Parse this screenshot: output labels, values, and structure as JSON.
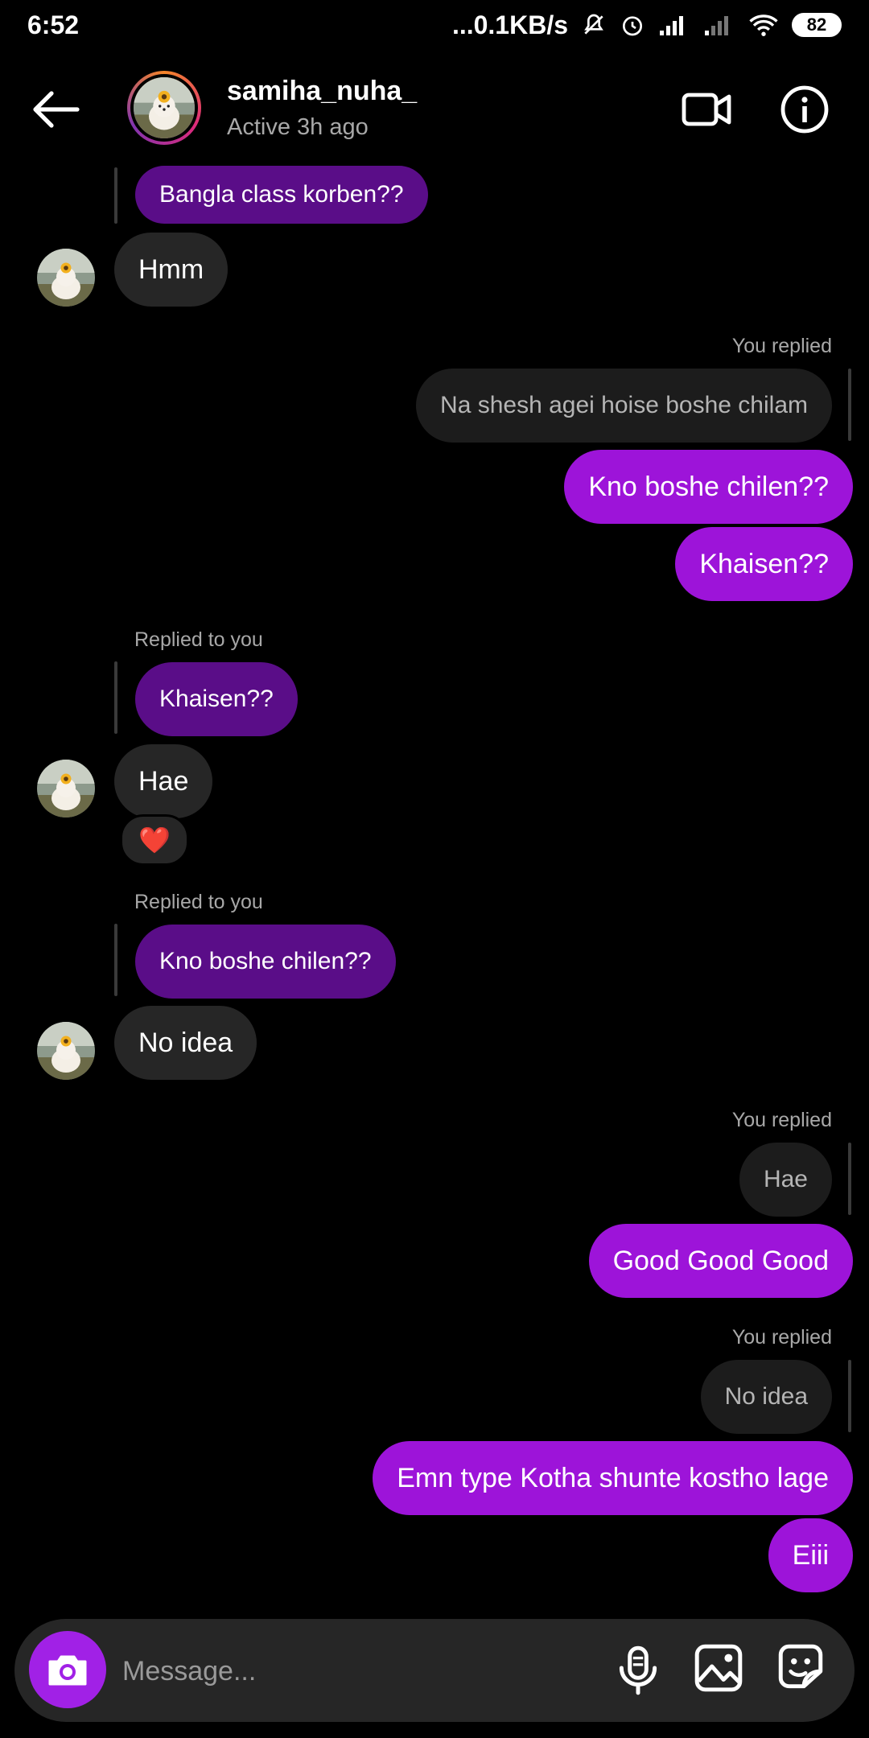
{
  "status_bar": {
    "time": "6:52",
    "network_speed": "...0.1KB/s",
    "battery": "82",
    "icons": [
      "mute-icon",
      "alarm-icon",
      "signal-icon",
      "signal-icon",
      "wifi-icon",
      "battery-icon"
    ]
  },
  "header": {
    "username": "samiha_nuha_",
    "status": "Active 3h ago",
    "icons": [
      "back-arrow-icon",
      "video-call-icon",
      "info-icon"
    ]
  },
  "messages": {
    "m1_quote": "Bangla class korben??",
    "m1_text": "Hmm",
    "m2_label": "You replied",
    "m2_quote": "Na shesh agei hoise boshe chilam",
    "m3_text": "Kno boshe chilen??",
    "m4_text": "Khaisen??",
    "m5_label": "Replied to you",
    "m5_quote": "Khaisen??",
    "m5_text": "Hae",
    "m5_reaction": "❤️",
    "m6_label": "Replied to you",
    "m6_quote": "Kno boshe chilen??",
    "m6_text": "No idea",
    "m7_label": "You replied",
    "m7_quote": "Hae",
    "m7_text": "Good Good Good",
    "m8_label": "You replied",
    "m8_quote": "No idea",
    "m8_text": "Emn type Kotha shunte kostho lage",
    "m9_text": "Eiii"
  },
  "composer": {
    "placeholder": "Message...",
    "icons": [
      "camera-icon",
      "microphone-icon",
      "gallery-icon",
      "sticker-icon"
    ]
  },
  "colors": {
    "outgoing_bubble": "#9d14d9",
    "incoming_bubble": "#262626",
    "quoted_incoming": "#5a0d88",
    "background": "#000000"
  }
}
